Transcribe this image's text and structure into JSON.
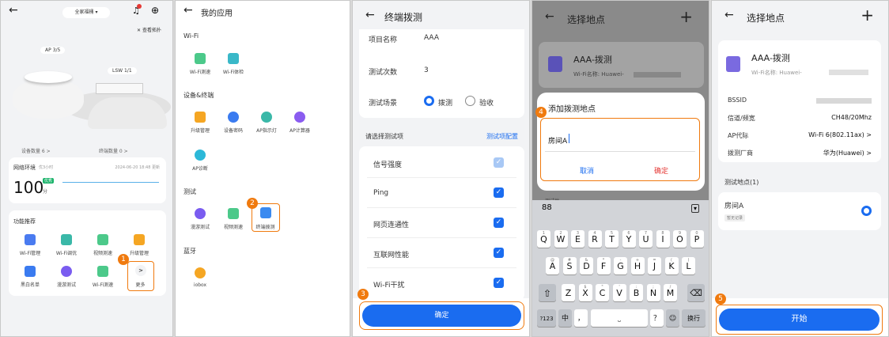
{
  "p1": {
    "site": "全家福桶 ",
    "view_topo": "查看拓扑",
    "ap": "AP 3/5",
    "lsw": "LSW 1/1",
    "device_count": "设备数量  6 >",
    "terminal_count": "终端数量  0 >",
    "network_env": "网络环境",
    "network_sub": "优3小时",
    "timestamp": "2024-06-20 18:48 更新",
    "score": "100",
    "score_unit": "分",
    "score_tag": "优秀",
    "features_title": "功能推荐",
    "features": [
      "Wi-Fi管理",
      "Wi-Fi调优",
      "视频测速",
      "升级管理",
      "黑白名单",
      "漫游测试",
      "Wi-Fi测速",
      "更多"
    ],
    "more_arrow": ">"
  },
  "p2": {
    "title": "我的应用",
    "sec_wifi": "Wi-Fi",
    "wifi_items": [
      "Wi-Fi测速",
      "Wi-Fi体检"
    ],
    "sec_device": "设备&终端",
    "device_items": [
      "升级管理",
      "设备密码",
      "AP指示灯",
      "AP计算器",
      "AP诊断"
    ],
    "sec_test": "测试",
    "test_items": [
      "漫游测试",
      "视频测速",
      "终端拨测"
    ],
    "sec_bt": "蓝牙",
    "bt_items": [
      "iobox"
    ]
  },
  "p3": {
    "title": "终端拨测",
    "project_label": "项目名称",
    "project_value": "AAA",
    "count_label": "测试次数",
    "count_value": "3",
    "scene_label": "测试场景",
    "scene_opt1": "拨测",
    "scene_opt2": "验收",
    "select_items": "请选择测试项",
    "config": "测试项配置",
    "items": [
      "信号强度",
      "Ping",
      "网页连通性",
      "互联网性能",
      "Wi-Fi干扰"
    ],
    "confirm": "确定",
    "check": "✓"
  },
  "p4": {
    "title": "选择地点",
    "plus": "+",
    "card_title": "AAA-拨测",
    "card_sub": "Wi-Fi名称: Huawei-",
    "dialog_title": "添加拨测地点",
    "input_value": "房间A",
    "cancel": "取消",
    "ok": "确定",
    "behind": "测试地",
    "kb_row1": [
      [
        "Q",
        "1"
      ],
      [
        "W",
        "2"
      ],
      [
        "E",
        "3"
      ],
      [
        "R",
        "4"
      ],
      [
        "T",
        "5"
      ],
      [
        "Y",
        "6"
      ],
      [
        "U",
        "7"
      ],
      [
        "I",
        "8"
      ],
      [
        "O",
        "9"
      ],
      [
        "P",
        "0"
      ]
    ],
    "kb_row2": [
      [
        "A",
        "@"
      ],
      [
        "S",
        "#"
      ],
      [
        "D",
        "&"
      ],
      [
        "F",
        "*"
      ],
      [
        "G",
        "-"
      ],
      [
        "H",
        "+"
      ],
      [
        "J",
        "="
      ],
      [
        "K",
        "("
      ],
      [
        "L",
        ")"
      ]
    ],
    "kb_row3": [
      [
        "Z",
        "_"
      ],
      [
        "X",
        "$"
      ],
      [
        "C",
        "\""
      ],
      [
        "V",
        "'"
      ],
      [
        "B",
        ":"
      ],
      [
        "N",
        ";"
      ],
      [
        "M",
        "/"
      ]
    ],
    "kb_123": "?123",
    "kb_lang": "中",
    "kb_punct": "，",
    "kb_q": "？",
    "kb_dot": "。",
    "kb_enter": "换行",
    "kb_grid": "88",
    "kb_shift": "⇧",
    "kb_del": "⌫"
  },
  "p5": {
    "title": "选择地点",
    "plus": "+",
    "card_title": "AAA-拨测",
    "card_sub": "Wi-Fi名称: Huawei-",
    "bssid_label": "BSSID",
    "bssid_value": "",
    "channel_label": "信道/频宽",
    "channel_value": "CH48/20Mhz",
    "ap_label": "AP代际",
    "ap_value": "Wi-Fi 6(802.11ax) >",
    "vendor_label": "拨测厂商",
    "vendor_value": "华为(Huawei) >",
    "points_title": "测试地点(1)",
    "point_name": "房间A",
    "point_tag": "暂无记录",
    "start": "开始"
  },
  "badges": [
    "1",
    "2",
    "3",
    "4",
    "5"
  ],
  "colors": {
    "accent": "#1a6cf0",
    "badge": "#f07a0e"
  }
}
